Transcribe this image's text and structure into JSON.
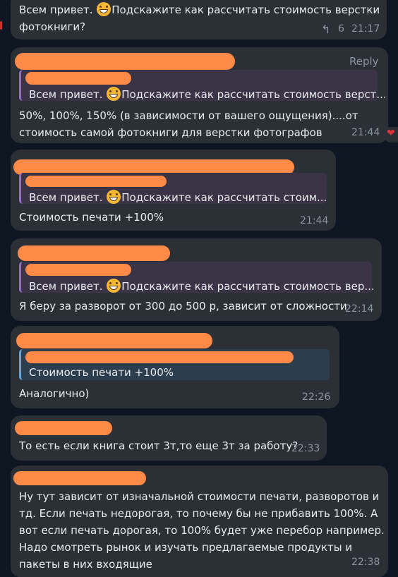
{
  "colors": {
    "background": "#0e1621",
    "bubble": "#2b3036",
    "quote_bar_purple": "#9a6ed0",
    "quote_bar_blue": "#62a6e0",
    "redaction": "#ff8a48",
    "reaction_heart": "#e0303a"
  },
  "messages": [
    {
      "lines": [
        "Всем привет. 😁Подскажите как рассчитать стоимость верстки",
        "фотокниги?"
      ],
      "reply_count": "6",
      "time": "21:17"
    },
    {
      "reply_label": "Reply",
      "quote": "Всем привет. 😁Подскажите как рассчитать стоимость верст...",
      "lines": [
        "50%, 100%, 150% (в зависимости от вашего ощущения)....от",
        "стоимость самой фотокниги для верстки фотографов"
      ],
      "time": "21:44",
      "reaction": "❤"
    },
    {
      "quote": "Всем привет. 😁Подскажите как рассчитать стоим...",
      "lines": [
        "Стоимость печати +100%"
      ],
      "time": "21:44"
    },
    {
      "quote": "Всем привет. 😁Подскажите как рассчитать стоимость вер...",
      "lines": [
        "Я беру за разворот от 300 до 500 р, зависит от сложности"
      ],
      "time": "22:14"
    },
    {
      "quote": "Стоимость печати +100%",
      "lines": [
        "Аналогично)"
      ],
      "time": "22:26"
    },
    {
      "lines": [
        "То есть если книга стоит 3т,то еще 3т за работу?"
      ],
      "time": "22:33"
    },
    {
      "lines": [
        "Ну тут зависит от изначальной стоимости печати, разворотов и",
        "тд. Если печать недорогая, то почему бы не прибавить 100%. А",
        "вот если печать дорогая, то 100% будет уже перебор например.",
        "Надо смотреть рынок и изучать предлагаемые продукты и",
        "пакеты в них входящие"
      ],
      "time": "22:38"
    }
  ]
}
